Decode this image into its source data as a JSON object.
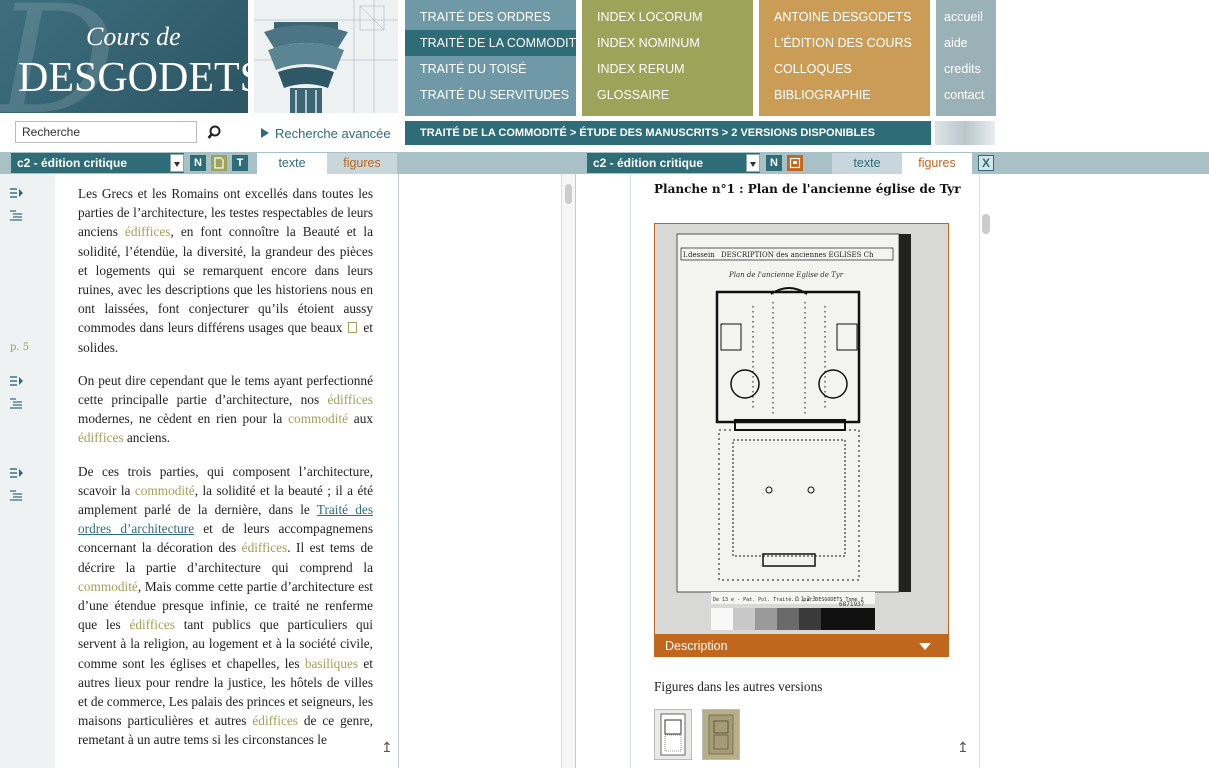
{
  "logo": {
    "line1": "Cours de",
    "line2": "DESGODETS"
  },
  "nav": {
    "col1": [
      "TRAITÉ DES ORDRES",
      "TRAITÉ DE LA COMMODITÉ",
      "TRAITÉ DU TOISÉ",
      "TRAITÉ DU SERVITUDES"
    ],
    "col2": [
      "INDEX LOCORUM",
      "INDEX NOMINUM",
      "INDEX RERUM",
      "GLOSSAIRE"
    ],
    "col3": [
      "ANTOINE DESGODETS",
      "L'ÉDITION DES COURS",
      "COLLOQUES",
      "BIBLIOGRAPHIE"
    ],
    "col4": [
      "accueil",
      "aide",
      "credits",
      "contact"
    ]
  },
  "search": {
    "value": "Recherche",
    "advanced": "Recherche avancée"
  },
  "breadcrumb": "TRAITÉ DE LA COMMODITÉ > ÉTUDE DES MANUSCRITS > 2 VERSIONS DISPONIBLES",
  "left": {
    "edition": "c2 - édition critique",
    "icons": [
      "N",
      "T"
    ],
    "tab_texte": "texte",
    "tab_figures": "figures",
    "page_marker": "p. 5",
    "p1": {
      "a": "Les Grecs et les Romains ont excellés dans toutes les parties de l’architecture, les testes respectables de leurs anciens ",
      "t1": "édiffices",
      "b": ", en font connoître la Beauté et la solidité, l’étendüe, la diversité, la grandeur des pièces et logements qui se remarquent encore dans leurs ruines, avec les descriptions que les historiens nous en ont laissées, font conjecturer qu’ils étoient aussy commodes dans leurs différens usages que beaux",
      "c": "et solides."
    },
    "p2": {
      "a": "On peut dire cependant que le tems ayant perfectionné cette principalle partie d’architecture, nos ",
      "t1": "édiffices",
      "b": " modernes, ne cèdent en rien pour la ",
      "t2": "commodité",
      "c": " aux ",
      "t3": "édiffices",
      "d": " anciens."
    },
    "p3": {
      "a": "De ces trois parties, qui composent l’architecture, scavoir la ",
      "t1": "commodité",
      "b": ", la solidité et la beauté ; il a été amplement parlé de la dernière, dans le ",
      "link": "Traité des ordres d’architecture",
      "c": " et de leurs accompagnemens concernant la décoration des ",
      "t2": "édiffices",
      "d": ". Il est tems de décrire la partie d’architecture qui comprend la ",
      "t3": "commodité",
      "e": ", Mais comme cette partie d’architecture est d’une étendue presque infinie, ce traité ne renferme que les ",
      "t4": "édiffices",
      "f": " tant publics que particuliers qui servent à la religion, au logement et à la société civile, comme sont les églises et chapelles, les ",
      "t5": "basiliques",
      "g": " et autres lieux pour rendre la justice, les hôtels de villes et de commerce, Les palais des princes et seigneurs, les maisons particulières et autres ",
      "t6": "édiffices",
      "h": " de ce genre, remetant à un autre tems si les circonstances le"
    }
  },
  "right": {
    "edition": "c2 - édition critique",
    "icons": [
      "N"
    ],
    "tab_texte": "texte",
    "tab_figures": "figures",
    "close": "X",
    "planche_title": "Planche n°1 : Plan de l'ancienne église de Tyr",
    "plate": {
      "header": "DESCRIPTION des anciennes EGLISES Ch",
      "header_left": "I.dessein",
      "subtitle": "Plan de l'ancienne Eglise de Tyr",
      "ref": "De 13 e - Pat. Pol. Traité... par DESGODETS Tome 2",
      "scale": "0 1 2 3",
      "code": "6871937"
    },
    "description": "Description",
    "other_versions": "Figures dans les autres versions"
  },
  "colors": {
    "teal": "#2e6c78",
    "olive": "#9da358",
    "orange": "#c0661d",
    "ochre": "#cb9c56"
  }
}
